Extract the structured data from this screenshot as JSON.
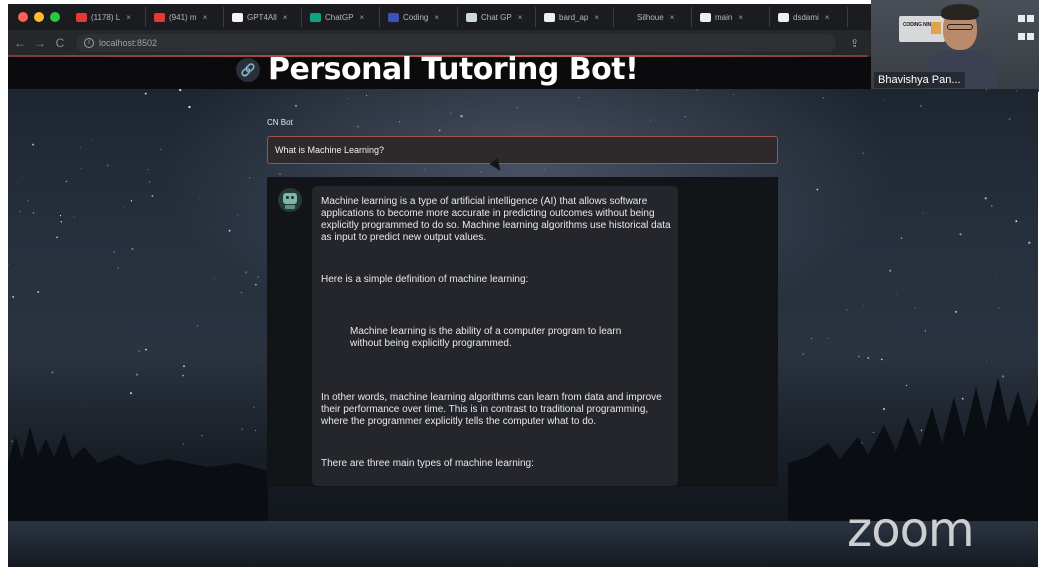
{
  "browser": {
    "traffic_colors": [
      "#ff5f57",
      "#febc2e",
      "#28c840"
    ],
    "tabs": [
      {
        "title": "(1178) L",
        "fav_color": "#e53935"
      },
      {
        "title": "(941) m",
        "fav_color": "#e53935"
      },
      {
        "title": "GPT4All",
        "fav_color": "#f5f5f5"
      },
      {
        "title": "ChatGP",
        "fav_color": "#10a37f"
      },
      {
        "title": "Coding",
        "fav_color": "#3f51b5"
      },
      {
        "title": "Chat GP",
        "fav_color": "#cfd8dc"
      },
      {
        "title": "bard_ap",
        "fav_color": "#eceff1"
      },
      {
        "title": "Silhoue",
        "fav_color": "#1b1c1f"
      },
      {
        "title": "main",
        "fav_color": "#eceff1"
      },
      {
        "title": "dsdami",
        "fav_color": "#eceff1"
      }
    ],
    "tab_close": "×",
    "back_icon": "←",
    "forward_icon": "→",
    "reload_icon": "C",
    "url": "localhost:8502",
    "share_icon": "⇪",
    "bookmark_icon": "☆"
  },
  "video": {
    "participant_name": "Bhavishya Pan...",
    "sign_text": "CODING NINJAS"
  },
  "page": {
    "link_icon": "🔗",
    "title": "Personal Tutoring Bot!",
    "input_label": "CN Bot",
    "input_value": "What is Machine Learning?",
    "response": {
      "p1": "Machine learning is a type of artificial intelligence (AI) that allows software applications to become more accurate in predicting outcomes without being explicitly programmed to do so. Machine learning algorithms use historical data as input to predict new output values.",
      "p2": "Here is a simple definition of machine learning:",
      "quote": "Machine learning is the ability of a computer program to learn without being explicitly programmed.",
      "p3": "In other words, machine learning algorithms can learn from data and improve their performance over time. This is in contrast to traditional programming, where the programmer explicitly tells the computer what to do.",
      "p4": "There are three main types of machine learning:"
    }
  },
  "watermark": "zoom"
}
